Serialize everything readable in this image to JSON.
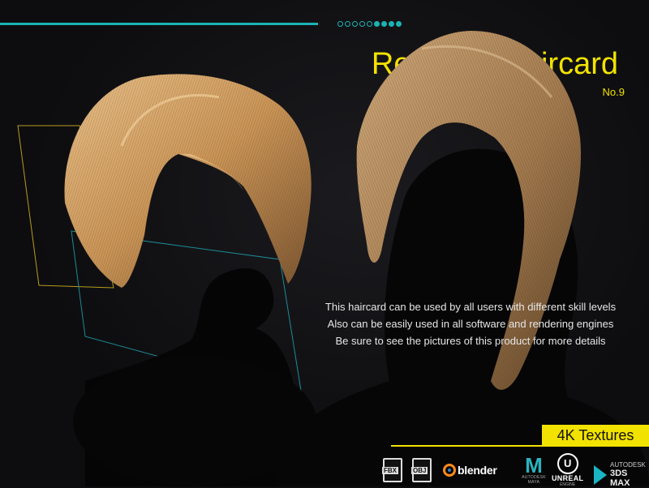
{
  "header": {
    "title": "Realtime Haircard",
    "subtitle": "No.9",
    "progress_dots": {
      "total": 9,
      "filled_from": 6
    }
  },
  "description": {
    "lines": [
      "This haircard can be used by all users with different skill levels",
      "Also can be easily used in all software and rendering engines",
      "Be sure to see the pictures of this product for more details"
    ]
  },
  "badge": {
    "label": "4K Textures"
  },
  "software": {
    "fbx": "FBX",
    "obj": "OBJ",
    "blender": "blender",
    "maya_letter": "M",
    "maya_caption": "AUTODESK MAYA",
    "unreal_letter": "U",
    "unreal_name": "UNREAL",
    "unreal_caption": "ENGINE",
    "max_top": "AUTODESK",
    "max_name": "3DS MAX"
  },
  "colors": {
    "accent_cyan": "#1bb3b3",
    "accent_yellow": "#f2e200",
    "background": "#0d0d0f",
    "hair_light": "#d9a66a",
    "hair_dark": "#8a6238"
  },
  "icons": [
    "fbx-file-icon",
    "obj-file-icon",
    "blender-icon",
    "maya-icon",
    "unreal-icon",
    "3ds-max-icon"
  ]
}
